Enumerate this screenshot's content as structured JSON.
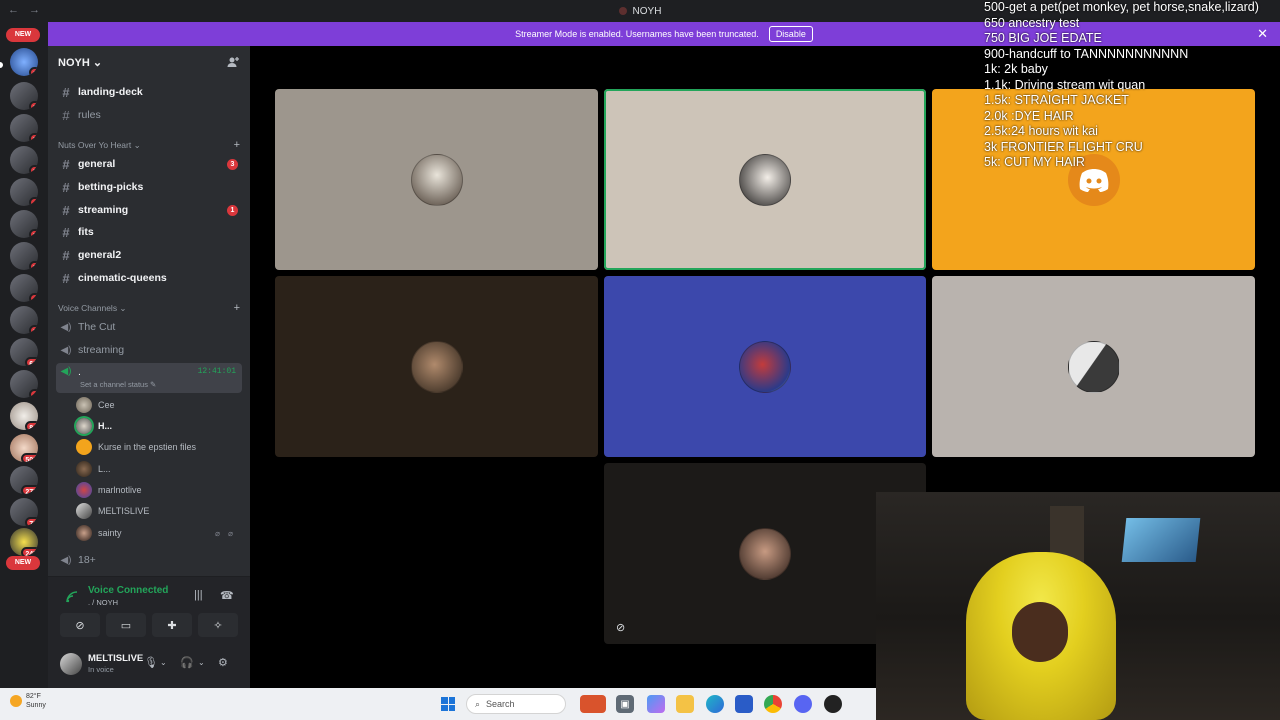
{
  "titlebar": {
    "title": "NOYH",
    "back": "←",
    "forward": "→"
  },
  "banner": {
    "text": "Streamer Mode is enabled. Usernames have been truncated.",
    "button": "Disable",
    "close": "✕",
    "color": "#7e3ed8"
  },
  "rail": {
    "new_top": "NEW",
    "new_bottom": "NEW",
    "badges": [
      "1",
      "2",
      "3",
      "2",
      "4",
      "3",
      "3",
      "4",
      "2",
      "2",
      "60",
      "4",
      "84",
      "500",
      "275",
      "78",
      "245"
    ]
  },
  "server": {
    "name": "NOYH ⌄"
  },
  "channels_top": [
    {
      "name": "landing-deck",
      "unread": true
    },
    {
      "name": "rules",
      "unread": false
    }
  ],
  "category_text": {
    "label": "Nuts Over Yo Heart ⌄",
    "plus": "+"
  },
  "text_channels": [
    {
      "name": "general",
      "unread": true,
      "badge": "3"
    },
    {
      "name": "betting-picks",
      "unread": true,
      "badge": ""
    },
    {
      "name": "streaming",
      "unread": true,
      "badge": "1"
    },
    {
      "name": "fits",
      "unread": true,
      "badge": ""
    },
    {
      "name": "general2",
      "unread": true,
      "badge": ""
    },
    {
      "name": "cinematic-queens",
      "unread": true,
      "badge": ""
    }
  ],
  "category_voice": {
    "label": "Voice Channels ⌄",
    "plus": "+"
  },
  "voice_channels": [
    {
      "name": "The Cut"
    },
    {
      "name": "streaming"
    }
  ],
  "active_voice": {
    "name": ".",
    "timer": "12:41:01",
    "status": "Set a channel status ✎"
  },
  "voice_users": [
    {
      "name": "Cee",
      "bold": false,
      "icons": ""
    },
    {
      "name": "H...",
      "bold": true,
      "icons": ""
    },
    {
      "name": "Kurse in the epstien files",
      "bold": false,
      "icons": ""
    },
    {
      "name": "L...",
      "bold": false,
      "icons": ""
    },
    {
      "name": "marlnotlive",
      "bold": false,
      "icons": ""
    },
    {
      "name": "MELTISLIVE",
      "bold": false,
      "icons": ""
    },
    {
      "name": "sainty",
      "bold": false,
      "icons": "⌀ ⌀"
    }
  ],
  "extra_channel": {
    "name": "18+"
  },
  "voice_panel": {
    "status": "Voice Connected",
    "location": ". / NOYH"
  },
  "user_panel": {
    "name": "MELTISLIVE",
    "status": "In voice"
  },
  "goals": [
    "500-get a pet(pet monkey, pet horse,snake,lizard)",
    "650 ancestry test",
    "750 BIG JOE EDATE",
    "900-handcuff to TANNNNNNNNNNN",
    "1k: 2k baby",
    "1.1k: Driving stream wit quan",
    "1.5k: STRAIGHT JACKET",
    "2.0k :DYE HAIR",
    "2.5k:24 hours wit kai",
    "3k FRONTIER FLIGHT CRU",
    "5k: CUT MY HAIR"
  ],
  "tiles_colors": {
    "t1": "#9d968d",
    "t2": "#cdc4b8",
    "t3": "#f3a41c",
    "t4": "#2b2219",
    "t5": "#3c48ac",
    "t6": "#b9b3ae",
    "t7": "#1c1a18"
  },
  "taskbar": {
    "temp": "82°F",
    "weather": "Sunny",
    "search": "Search"
  }
}
